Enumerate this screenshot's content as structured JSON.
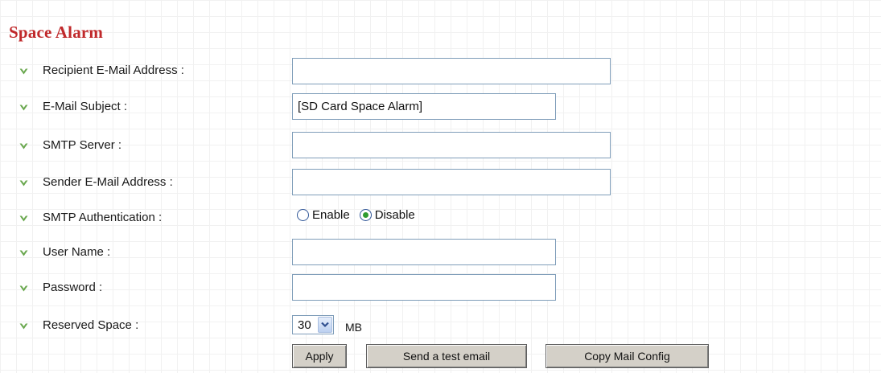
{
  "section": {
    "title": "Space Alarm"
  },
  "form": {
    "recipient_email": {
      "label": "Recipient E-Mail Address :",
      "value": ""
    },
    "email_subject": {
      "label": "E-Mail Subject :",
      "value": "[SD Card Space Alarm]"
    },
    "smtp_server": {
      "label": "SMTP Server :",
      "value": ""
    },
    "sender_email": {
      "label": "Sender E-Mail Address :",
      "value": ""
    },
    "smtp_auth": {
      "label": "SMTP Authentication :",
      "options": [
        "Enable",
        "Disable"
      ],
      "selected": "Disable"
    },
    "user_name": {
      "label": "User Name :",
      "value": ""
    },
    "password": {
      "label": "Password :",
      "value": ""
    },
    "reserved_space": {
      "label": "Reserved Space :",
      "value": "30",
      "unit": "MB"
    }
  },
  "buttons": {
    "apply": "Apply",
    "send_test": "Send a test email",
    "copy_config": "Copy Mail Config"
  },
  "colors": {
    "title": "#c0292b",
    "bullet": "#6aa84f"
  },
  "icons": {
    "bullet": "green-check-chevron-icon",
    "dropdown": "chevron-down-icon"
  }
}
